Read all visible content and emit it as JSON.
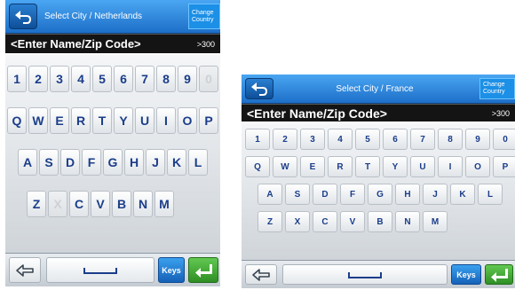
{
  "colors": {
    "accent": "#2f8ad8",
    "input_bg": "#141414",
    "key_text": "#1b3e8a",
    "enter": "#3aa832"
  },
  "screens": [
    {
      "title": "Select City / Netherlands",
      "change_country": "Change Country",
      "input_placeholder": "<Enter Name/Zip Code>",
      "result_count": ">300",
      "rows": [
        [
          "1",
          "2",
          "3",
          "4",
          "5",
          "6",
          "7",
          "8",
          "9",
          "0"
        ],
        [
          "Q",
          "W",
          "E",
          "R",
          "T",
          "Y",
          "U",
          "I",
          "O",
          "P"
        ],
        [
          "A",
          "S",
          "D",
          "F",
          "G",
          "H",
          "J",
          "K",
          "L"
        ],
        [
          "Z",
          "X",
          "C",
          "V",
          "B",
          "N",
          "M"
        ]
      ],
      "disabled_keys": [
        "0",
        "X"
      ],
      "space_label": "␣",
      "keys_label": "Keys"
    },
    {
      "title": "Select City / France",
      "change_country": "Change Country",
      "input_placeholder": "<Enter Name/Zip Code>",
      "result_count": ">300",
      "rows": [
        [
          "1",
          "2",
          "3",
          "4",
          "5",
          "6",
          "7",
          "8",
          "9",
          "0"
        ],
        [
          "Q",
          "W",
          "E",
          "R",
          "T",
          "Y",
          "U",
          "I",
          "O",
          "P"
        ],
        [
          "A",
          "S",
          "D",
          "F",
          "G",
          "H",
          "J",
          "K",
          "L"
        ],
        [
          "Z",
          "X",
          "C",
          "V",
          "B",
          "N",
          "M"
        ]
      ],
      "disabled_keys": [],
      "space_label": "␣",
      "keys_label": "Keys"
    }
  ]
}
